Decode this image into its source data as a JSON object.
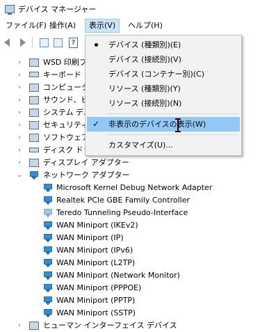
{
  "window": {
    "title": "デバイス マネージャー"
  },
  "menubar": [
    {
      "label": "ファイル(F)"
    },
    {
      "label": "操作(A)"
    },
    {
      "label": "表示(V)"
    },
    {
      "label": "ヘルプ(H)"
    }
  ],
  "view_menu": {
    "items": [
      {
        "label": "デバイス (種類別)(E)",
        "marker": "dot"
      },
      {
        "label": "デバイス (接続別)(V)",
        "marker": ""
      },
      {
        "label": "デバイス (コンテナー別)(C)",
        "marker": ""
      },
      {
        "label": "リソース (種類別)(Y)",
        "marker": ""
      },
      {
        "label": "リソース (接続別)(N)",
        "marker": ""
      },
      {
        "label": "非表示のデバイスの表示(W)",
        "marker": "check",
        "highlighted": true
      },
      {
        "label": "カスタマイズ(U)...",
        "marker": ""
      }
    ]
  },
  "tree": {
    "categories_above": [
      {
        "label": "WSD 印刷プ"
      },
      {
        "label": "キーボード"
      },
      {
        "label": "コンピューター"
      },
      {
        "label": "サウンド、ビデ"
      },
      {
        "label": "システム デバ"
      },
      {
        "label": "セキュリティ"
      },
      {
        "label": "ソフトウェア デ"
      },
      {
        "label": "ディスク ドライ"
      },
      {
        "label": "ディスプレイ アダプター"
      }
    ],
    "network": {
      "label": "ネットワーク アダプター",
      "children": [
        {
          "label": "Microsoft Kernel Debug Network Adapter",
          "faded": false
        },
        {
          "label": "Realtek PCIe GBE Family Controller",
          "faded": false
        },
        {
          "label": "Teredo Tunneling Pseudo-Interface",
          "faded": true
        },
        {
          "label": "WAN Miniport (IKEv2)",
          "faded": false
        },
        {
          "label": "WAN Miniport (IP)",
          "faded": false
        },
        {
          "label": "WAN Miniport (IPv6)",
          "faded": false
        },
        {
          "label": "WAN Miniport (L2TP)",
          "faded": false
        },
        {
          "label": "WAN Miniport (Network Monitor)",
          "faded": false
        },
        {
          "label": "WAN Miniport (PPPOE)",
          "faded": false
        },
        {
          "label": "WAN Miniport (PPTP)",
          "faded": false
        },
        {
          "label": "WAN Miniport (SSTP)",
          "faded": false
        }
      ]
    },
    "categories_below": [
      {
        "label": "ヒューマン インターフェイス デバイス"
      }
    ]
  },
  "colors": {
    "menu_highlight": "#91c9f7",
    "menubar_active": "#cce4f7",
    "network_icon": "#2f8fd8"
  }
}
